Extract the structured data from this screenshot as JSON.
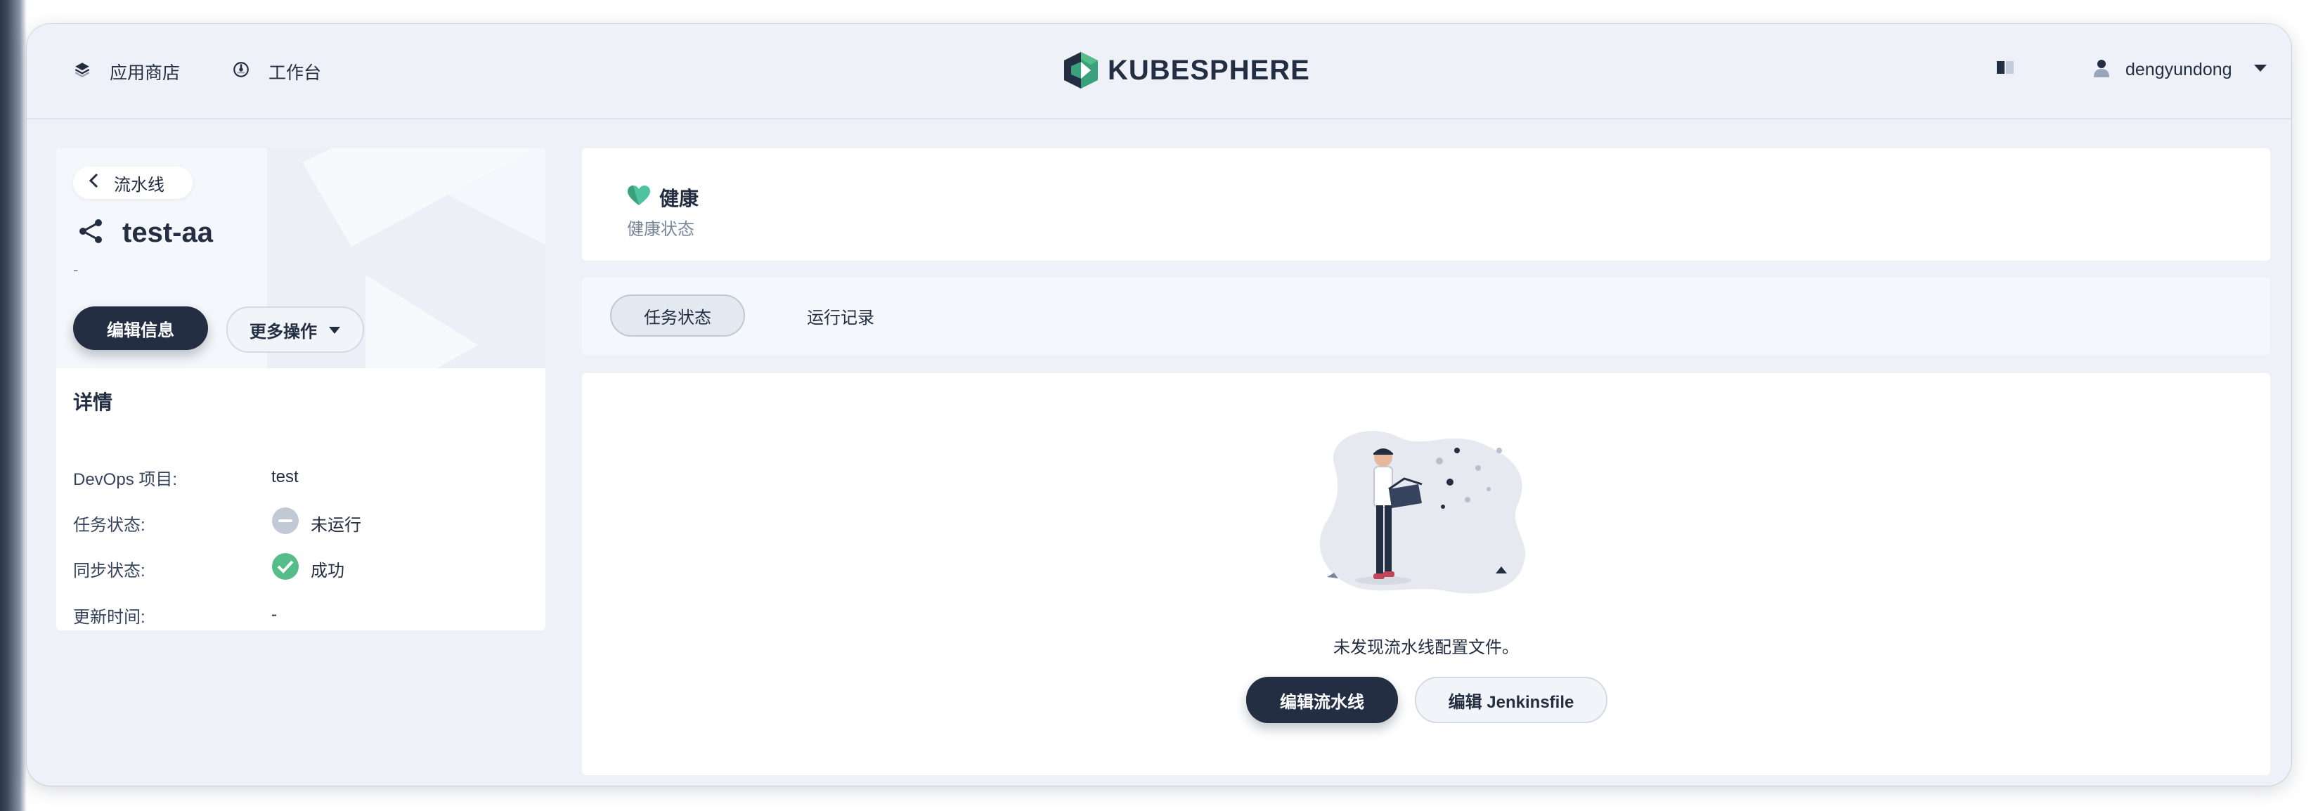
{
  "header": {
    "nav": [
      {
        "label": "应用商店",
        "icon": "layers-icon"
      },
      {
        "label": "工作台",
        "icon": "dashboard-icon"
      }
    ],
    "logo_text": "KUBESPHERE",
    "user_name": "dengyundong"
  },
  "sidebar": {
    "back_label": "流水线",
    "title": "test-aa",
    "description": "-",
    "edit_button": "编辑信息",
    "more_button": "更多操作",
    "details_title": "详情",
    "details": [
      {
        "label": "DevOps 项目:",
        "value": "test"
      },
      {
        "label": "任务状态:",
        "value": "未运行",
        "status": "not-running"
      },
      {
        "label": "同步状态:",
        "value": "成功",
        "status": "success"
      },
      {
        "label": "更新时间:",
        "value": "-"
      }
    ]
  },
  "health": {
    "title": "健康",
    "subtitle": "健康状态"
  },
  "tabs": [
    {
      "label": "任务状态",
      "active": true
    },
    {
      "label": "运行记录",
      "active": false
    }
  ],
  "empty": {
    "message": "未发现流水线配置文件。",
    "edit_pipeline_button": "编辑流水线",
    "edit_jenkinsfile_button": "编辑 Jenkinsfile"
  },
  "colors": {
    "dark": "#242e42",
    "success": "#55bc8a",
    "health": "#4fc3a0",
    "muted": "#79879c"
  }
}
